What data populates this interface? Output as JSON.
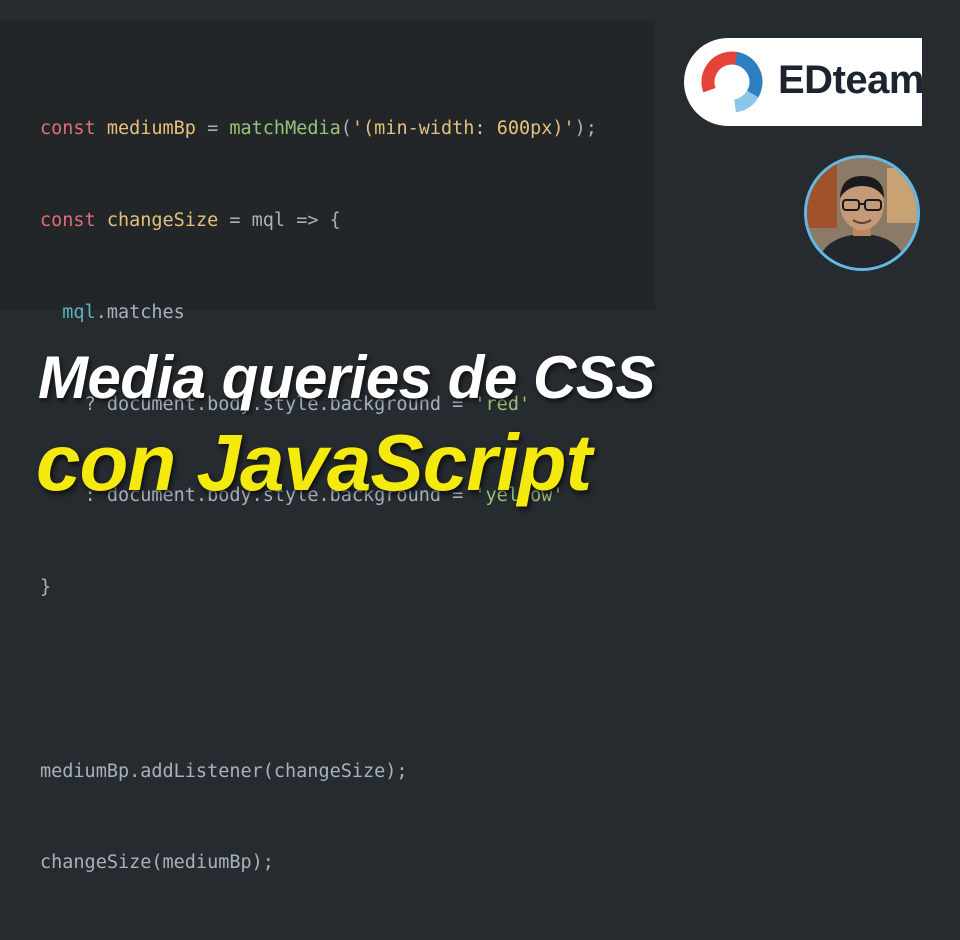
{
  "code": {
    "line1": {
      "kw": "const",
      "name": "mediumBp",
      "eq": " = ",
      "fn": "matchMedia",
      "open": "(",
      "str": "'(min-width: 600px)'",
      "close": ");"
    },
    "line2": {
      "kw": "const",
      "name": "changeSize",
      "rest": " = mql => {"
    },
    "line3": {
      "obj": "mql",
      "rest": ".matches"
    },
    "line4": {
      "op": "? ",
      "rest": "document.body.style.background = ",
      "str": "'red'"
    },
    "line5": {
      "op": ": ",
      "rest": "document.body.style.background = ",
      "str": "'yellow'"
    },
    "line6": "}",
    "line7": "",
    "line8": "mediumBp.addListener(changeSize);",
    "line9": "changeSize(mediumBp);"
  },
  "brand": {
    "name": "EDteam",
    "logo_icon": "edteam-ring-logo"
  },
  "avatar": {
    "icon": "presenter-avatar"
  },
  "title": {
    "line1": "Media queries de CSS",
    "line2": "con JavaScript"
  },
  "colors": {
    "background": "#262b30",
    "keyword": "#e06c75",
    "identifier": "#98c379",
    "string": "#e5c07b",
    "title_accent": "#f5ea0e"
  }
}
